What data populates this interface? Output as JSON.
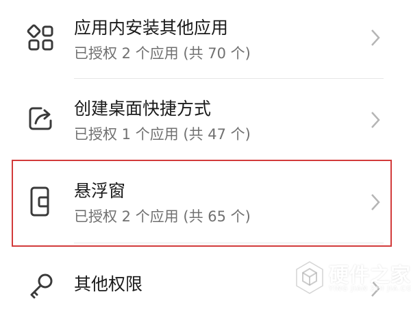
{
  "items": [
    {
      "icon": "app-grid-icon",
      "title": "应用内安装其他应用",
      "subtitle": "已授权 2 个应用 (共 70 个)"
    },
    {
      "icon": "shortcut-share-icon",
      "title": "创建桌面快捷方式",
      "subtitle": "已授权 1 个应用 (共 47 个)"
    },
    {
      "icon": "floating-window-icon",
      "title": "悬浮窗",
      "subtitle": "已授权 2 个应用 (共 65 个)",
      "highlighted": true
    },
    {
      "icon": "key-icon",
      "title": "其他权限",
      "subtitle": ""
    }
  ],
  "colors": {
    "highlight_border": "#d23a3a",
    "title_text": "#1a1a1a",
    "subtitle_text": "#707070",
    "icon_stroke": "#3a3a3a",
    "chevron": "#b5b5b5"
  },
  "watermark": {
    "title": "硬件之家",
    "subtitle": "YING JIAN ZHI JIA.COM",
    "icon": "hexagon-logo-icon"
  }
}
